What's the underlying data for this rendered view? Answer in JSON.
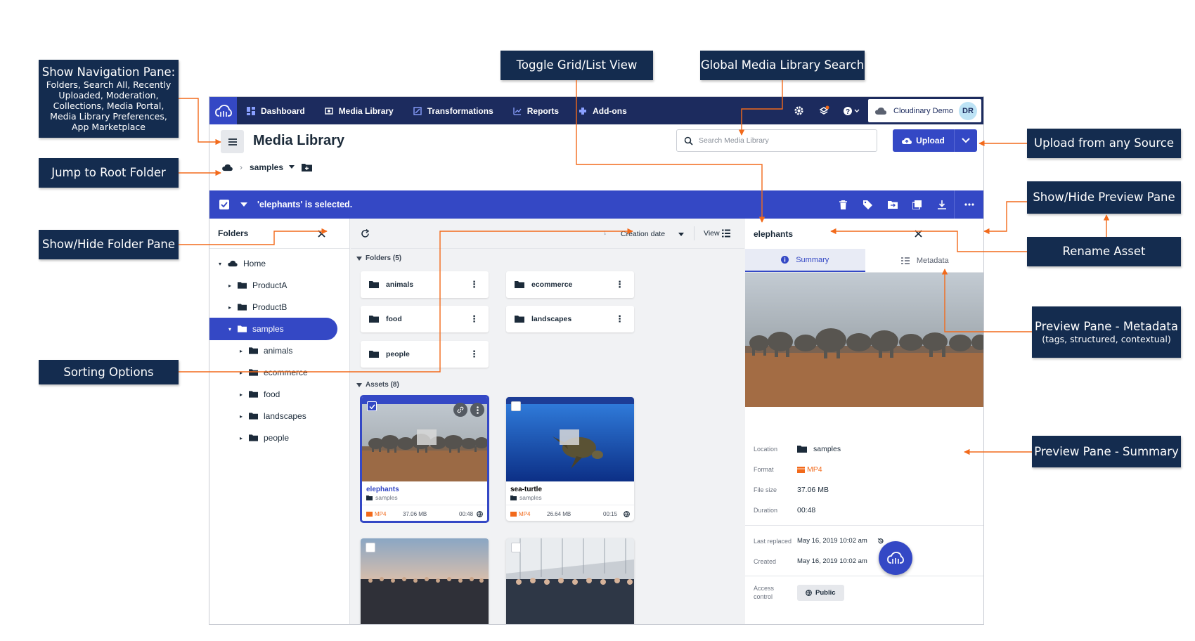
{
  "annotations": {
    "nav_pane_title": "Show Navigation Pane:",
    "nav_pane_lines": [
      "Folders, Search All, Recently",
      "Uploaded, Moderation,",
      "Collections,  Media Portal,",
      "Media Library Preferences,",
      "App  Marketplace"
    ],
    "jump_root": "Jump to Root Folder",
    "folder_pane": "Show/Hide Folder Pane",
    "sorting": "Sorting Options",
    "toggle_view": "Toggle Grid/List View",
    "global_search": "Global Media Library Search",
    "upload_source": "Upload from any Source",
    "preview_pane": "Show/Hide  Preview Pane",
    "rename_asset": "Rename Asset",
    "metadata_title": "Preview Pane - Metadata",
    "metadata_sub": "(tags, structured, contextual)",
    "summary": "Preview Pane - Summary"
  },
  "topnav": {
    "items": [
      {
        "label": "Dashboard",
        "icon": "dashboard-icon"
      },
      {
        "label": "Media Library",
        "icon": "media-library-icon"
      },
      {
        "label": "Transformations",
        "icon": "transformations-icon"
      },
      {
        "label": "Reports",
        "icon": "reports-icon"
      },
      {
        "label": "Add-ons",
        "icon": "addons-icon"
      }
    ],
    "account_name": "Cloudinary Demo",
    "avatar_initials": "DR"
  },
  "header": {
    "title": "Media Library",
    "search_placeholder": "Search Media Library",
    "upload_label": "Upload",
    "breadcrumb": "samples"
  },
  "selection_bar": {
    "text": "'elephants' is selected."
  },
  "folders_pane": {
    "title": "Folders",
    "tree": [
      {
        "label": "Home"
      },
      {
        "label": "ProductA"
      },
      {
        "label": "ProductB"
      },
      {
        "label": "samples"
      },
      {
        "label": "animals"
      },
      {
        "label": "ecommerce"
      },
      {
        "label": "food"
      },
      {
        "label": "landscapes"
      },
      {
        "label": "people"
      }
    ]
  },
  "main": {
    "sort_label": "Creation date",
    "view_label": "View",
    "folders_section": "Folders (5)",
    "folders": [
      "animals",
      "ecommerce",
      "food",
      "landscapes",
      "people"
    ],
    "assets_section": "Assets (8)",
    "assets": [
      {
        "name": "elephants",
        "folder": "samples",
        "format": "MP4",
        "size": "37.06 MB",
        "duration": "00:48"
      },
      {
        "name": "sea-turtle",
        "folder": "samples",
        "format": "MP4",
        "size": "26.64 MB",
        "duration": "00:15"
      }
    ]
  },
  "preview": {
    "title": "elephants",
    "tab_summary": "Summary",
    "tab_metadata": "Metadata",
    "location_key": "Location",
    "location_val": "samples",
    "format_key": "Format",
    "format_val": "MP4",
    "size_key": "File size",
    "size_val": "37.06 MB",
    "duration_key": "Duration",
    "duration_val": "00:48",
    "replaced_key": "Last replaced",
    "replaced_val": "May 16, 2019 10:02 am",
    "created_key": "Created",
    "created_val": "May 16, 2019 10:02 am",
    "access_key_1": "Access",
    "access_key_2": "control",
    "access_val": "Public"
  },
  "colors": {
    "nav_bg": "#1c2b5e",
    "accent": "#3448c5",
    "callout_bg": "#142c4f",
    "arrow": "#f26a1b",
    "format_orange": "#f26a1b"
  }
}
